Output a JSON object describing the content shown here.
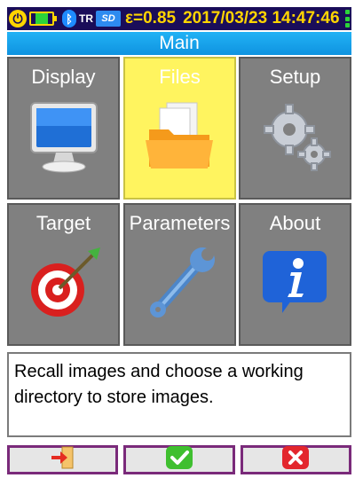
{
  "status_bar": {
    "power_icon": "power-icon",
    "battery_icon": "battery-icon",
    "battery_level": 0.6,
    "bluetooth_icon": "bluetooth-icon",
    "thermometer_label": "TR",
    "sd_label": "SD",
    "emissivity": "ε=0.85",
    "datetime": "2017/03/23 14:47:46",
    "colors": {
      "background": "#1a0d59",
      "text": "#ffd400"
    }
  },
  "title": "Main",
  "tiles": [
    {
      "label": "Display",
      "icon": "monitor-icon",
      "selected": false
    },
    {
      "label": "Files",
      "icon": "folder-icon",
      "selected": true
    },
    {
      "label": "Setup",
      "icon": "gears-icon",
      "selected": false
    },
    {
      "label": "Target",
      "icon": "dart-target-icon",
      "selected": false
    },
    {
      "label": "Parameters",
      "icon": "wrench-icon",
      "selected": false
    },
    {
      "label": "About",
      "icon": "info-icon",
      "selected": false
    }
  ],
  "description": "Recall images and choose a working directory to store images.",
  "buttons": [
    {
      "icon": "exit-icon"
    },
    {
      "icon": "confirm-check-icon"
    },
    {
      "icon": "cancel-x-icon"
    }
  ],
  "colors": {
    "title_bar": "#13a3ea",
    "tile_default": "#808080",
    "tile_selected": "#fff45f",
    "button_border": "#7a2a7a"
  }
}
